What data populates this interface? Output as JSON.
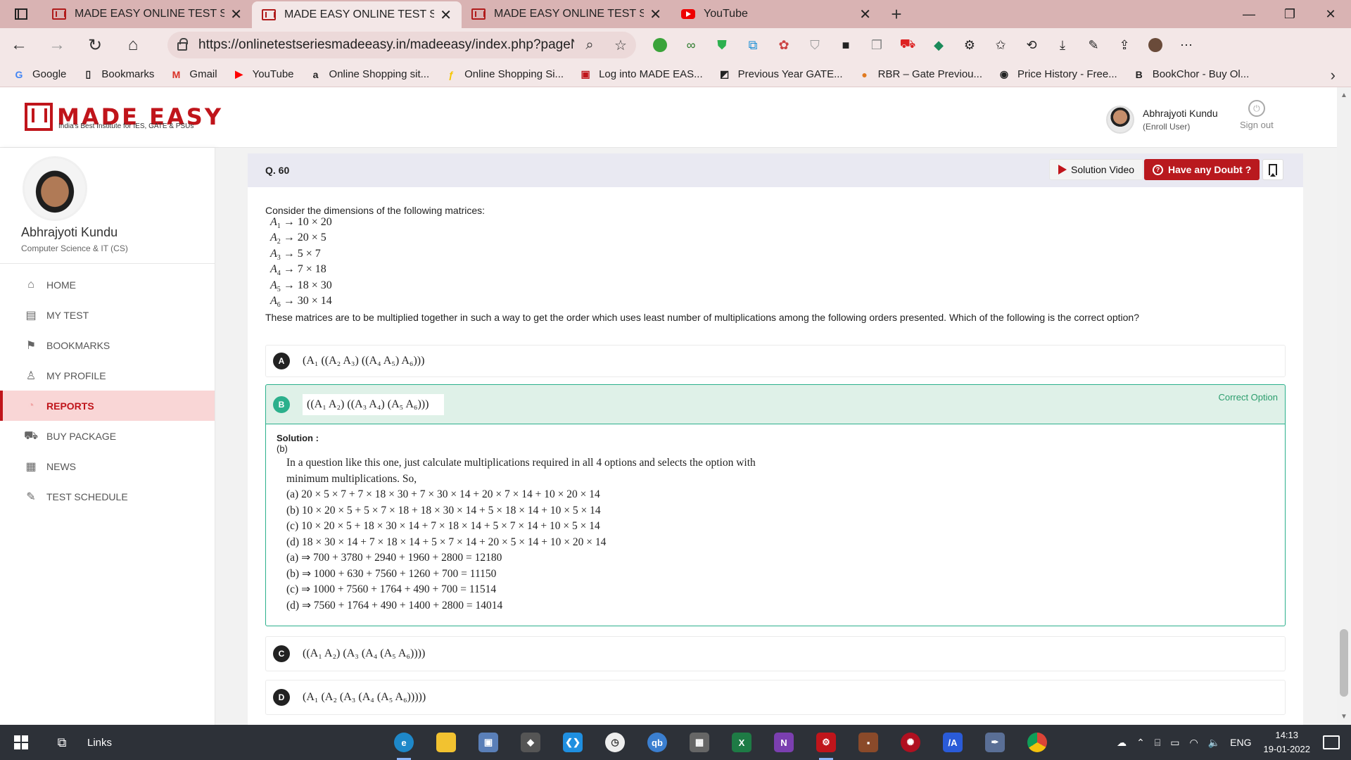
{
  "browser": {
    "tabs": [
      {
        "title": "MADE EASY ONLINE TEST SERIES",
        "icon": "madeeasy-favicon",
        "active": false
      },
      {
        "title": "MADE EASY ONLINE TEST SERIES",
        "icon": "madeeasy-favicon",
        "active": true
      },
      {
        "title": "MADE EASY ONLINE TEST SERIES",
        "icon": "madeeasy-favicon",
        "active": false
      },
      {
        "title": "YouTube",
        "icon": "youtube-favicon",
        "active": false
      }
    ],
    "url": "https://onlinetestseriesmadeeasy.in/madeeasy/index.php?pageN...",
    "bookmarks": [
      {
        "label": "Google",
        "icon": "google-icon"
      },
      {
        "label": "Bookmarks",
        "icon": "file-icon"
      },
      {
        "label": "Gmail",
        "icon": "gmail-icon"
      },
      {
        "label": "YouTube",
        "icon": "youtube-icon"
      },
      {
        "label": "Online Shopping sit...",
        "icon": "amazon-icon"
      },
      {
        "label": "Online Shopping Si...",
        "icon": "flipkart-icon"
      },
      {
        "label": "Log into MADE EAS...",
        "icon": "madeeasy-icon"
      },
      {
        "label": "Previous Year GATE...",
        "icon": "gate-icon"
      },
      {
        "label": "RBR – Gate Previou...",
        "icon": "rbr-icon"
      },
      {
        "label": "Price History - Free...",
        "icon": "pricehistory-icon"
      },
      {
        "label": "BookChor - Buy Ol...",
        "icon": "bookchor-icon"
      }
    ]
  },
  "site": {
    "logo_text": "MADE EASY",
    "logo_tagline": "India's Best Institute for IES, GATE & PSUs",
    "user_name": "Abhrajyoti Kundu",
    "user_role": "(Enroll User)",
    "signout_label": "Sign out"
  },
  "sidebar": {
    "name": "Abhrajyoti Kundu",
    "dept": "Computer Science & IT (CS)",
    "items": [
      {
        "label": "HOME",
        "icon": "home-icon",
        "active": false
      },
      {
        "label": "MY TEST",
        "icon": "test-icon",
        "active": false
      },
      {
        "label": "BOOKMARKS",
        "icon": "bookmark-icon",
        "active": false
      },
      {
        "label": "MY PROFILE",
        "icon": "user-icon",
        "active": false
      },
      {
        "label": "REPORTS",
        "icon": "pie-chart-icon",
        "active": true
      },
      {
        "label": "BUY PACKAGE",
        "icon": "cart-icon",
        "active": false
      },
      {
        "label": "NEWS",
        "icon": "news-icon",
        "active": false
      },
      {
        "label": "TEST SCHEDULE",
        "icon": "schedule-icon",
        "active": false
      }
    ]
  },
  "question": {
    "number": "Q. 60",
    "solution_video_label": "Solution Video",
    "doubt_label": "Have any Doubt ?",
    "intro": "Consider the dimensions of the following matrices:",
    "matrices": [
      {
        "name": "A",
        "sub": "1",
        "dims": "→ 10 × 20"
      },
      {
        "name": "A",
        "sub": "2",
        "dims": "→ 20 × 5"
      },
      {
        "name": "A",
        "sub": "3",
        "dims": "→ 5 × 7"
      },
      {
        "name": "A",
        "sub": "4",
        "dims": "→ 7 × 18"
      },
      {
        "name": "A",
        "sub": "5",
        "dims": "→ 18 × 30"
      },
      {
        "name": "A",
        "sub": "6",
        "dims": "→ 30 × 14"
      }
    ],
    "tail": "These matrices are to be multiplied together in such a way to get the order which uses least number of multiplications among the following orders presented. Which of the following is the correct option?"
  },
  "options": [
    {
      "letter": "A",
      "text": "(A₁ ((A₂ A₃) ((A₄ A₅) A₆)))"
    },
    {
      "letter": "B",
      "text": "((A₁ A₂) ((A₃ A₄) (A₅ A₆)))",
      "correct_label": "Correct Option"
    },
    {
      "letter": "C",
      "text": "((A₁ A₂) (A₃ (A₄ (A₅ A₆))))"
    },
    {
      "letter": "D",
      "text": "(A₁ (A₂ (A₃ (A₄ (A₅ A₆)))))"
    }
  ],
  "solution": {
    "heading": "Solution :",
    "answer": "(b)",
    "paragraph": "In a question like this one, just calculate multiplications required in all 4 options and selects the option with minimum multiplications. So,",
    "lines": [
      "(a)  20 × 5 × 7 + 7 × 18 × 30 + 7 × 30 × 14 + 20 × 7 × 14 + 10 × 20 × 14",
      "(b)  10 × 20 × 5 + 5 × 7 × 18 + 18 × 30 × 14 + 5 × 18 × 14 + 10 × 5 × 14",
      "(c)  10 × 20 × 5 + 18 × 30 × 14 + 7 × 18 × 14 + 5 × 7 × 14 + 10 × 5 × 14",
      "(d)  18 × 30 × 14 + 7 × 18 × 14 + 5 × 7 × 14 + 20 × 5 × 14 + 10 × 20 × 14",
      "(a) ⇒  700 + 3780 + 2940 + 1960 + 2800 = 12180",
      "(b) ⇒  1000 + 630 + 7560 + 1260 + 700 = 11150",
      "(c) ⇒  1000 + 7560 + 1764 + 490 + 700 = 11514",
      "(d) ⇒  7560 + 1764 + 490 + 1400 + 2800 = 14014"
    ]
  },
  "taskbar": {
    "links_label": "Links",
    "language": "ENG",
    "time": "14:13",
    "date": "19-01-2022"
  },
  "colors": {
    "brand_red": "#c0151b",
    "doubt_red": "#b9191e",
    "correct_green": "#2bb08c",
    "correct_bg": "#dff1e8",
    "active_menu_bg": "#f9d6d6",
    "browser_tab_bg": "#d9b3b3"
  }
}
